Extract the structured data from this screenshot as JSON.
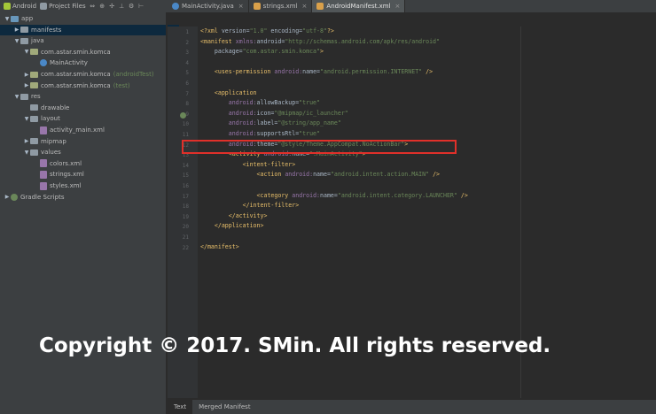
{
  "topbar": {
    "project_view": "Android",
    "files_view": "Project Files",
    "toolbar_icons": [
      "split-icon",
      "sync-icon",
      "collapse-icon",
      "settings-icon",
      "hide-icon"
    ]
  },
  "editor_tabs": [
    {
      "label": "MainActivity.java",
      "active": false
    },
    {
      "label": "strings.xml",
      "active": false
    },
    {
      "label": "AndroidManifest.xml",
      "active": true
    }
  ],
  "tree": [
    {
      "label": "app",
      "indent": 0,
      "expanded": true,
      "kind": "module"
    },
    {
      "label": "manifests",
      "indent": 1,
      "expanded": false,
      "kind": "folder",
      "selected": true
    },
    {
      "label": "java",
      "indent": 1,
      "expanded": true,
      "kind": "folder"
    },
    {
      "label": "com.astar.smin.komca",
      "indent": 2,
      "expanded": true,
      "kind": "package"
    },
    {
      "label": "MainActivity",
      "indent": 3,
      "expanded": null,
      "kind": "class"
    },
    {
      "label": "com.astar.smin.komca",
      "suffix": "(androidTest)",
      "indent": 2,
      "expanded": false,
      "kind": "package"
    },
    {
      "label": "com.astar.smin.komca",
      "suffix": "(test)",
      "indent": 2,
      "expanded": false,
      "kind": "package"
    },
    {
      "label": "res",
      "indent": 1,
      "expanded": true,
      "kind": "folder"
    },
    {
      "label": "drawable",
      "indent": 2,
      "expanded": null,
      "kind": "folder"
    },
    {
      "label": "layout",
      "indent": 2,
      "expanded": true,
      "kind": "folder"
    },
    {
      "label": "activity_main.xml",
      "indent": 3,
      "expanded": null,
      "kind": "file"
    },
    {
      "label": "mipmap",
      "indent": 2,
      "expanded": false,
      "kind": "folder"
    },
    {
      "label": "values",
      "indent": 2,
      "expanded": true,
      "kind": "folder"
    },
    {
      "label": "colors.xml",
      "indent": 3,
      "expanded": null,
      "kind": "file"
    },
    {
      "label": "strings.xml",
      "indent": 3,
      "expanded": null,
      "kind": "file"
    },
    {
      "label": "styles.xml",
      "indent": 3,
      "expanded": null,
      "kind": "file"
    },
    {
      "label": "Gradle Scripts",
      "indent": 0,
      "expanded": false,
      "kind": "gradle"
    }
  ],
  "code_lines": [
    "<?xml version=\"1.0\" encoding=\"utf-8\"?>",
    "<manifest xmlns:android=\"http://schemas.android.com/apk/res/android\"",
    "    package=\"com.astar.smin.komca\">",
    "",
    "    <uses-permission android:name=\"android.permission.INTERNET\" />",
    "",
    "    <application",
    "        android:allowBackup=\"true\"",
    "        android:icon=\"@mipmap/ic_launcher\"",
    "        android:label=\"@string/app_name\"",
    "        android:supportsRtl=\"true\"",
    "        android:theme=\"@style/Theme.AppCompat.NoActionBar\">",
    "        <activity android:name=\".MainActivity\">",
    "            <intent-filter>",
    "                <action android:name=\"android.intent.action.MAIN\" />",
    "",
    "                <category android:name=\"android.intent.category.LAUNCHER\" />",
    "            </intent-filter>",
    "        </activity>",
    "    </application>",
    "",
    "</manifest>"
  ],
  "line_numbers": [
    "1",
    "2",
    "3",
    "4",
    "5",
    "6",
    "7",
    "8",
    "9",
    "10",
    "11",
    "12",
    "13",
    "14",
    "15",
    "16",
    "17",
    "18",
    "19",
    "20",
    "21",
    "22"
  ],
  "bottom_tabs": [
    {
      "label": "Text",
      "active": true
    },
    {
      "label": "Merged Manifest",
      "active": false
    }
  ],
  "watermark": "Copyright © 2017. SMin. All rights reserved.",
  "colors": {
    "highlight_box": "#e0302a",
    "selection": "#0d293e",
    "xml_tag": "#e8bf6a",
    "xml_value": "#6a8759"
  }
}
